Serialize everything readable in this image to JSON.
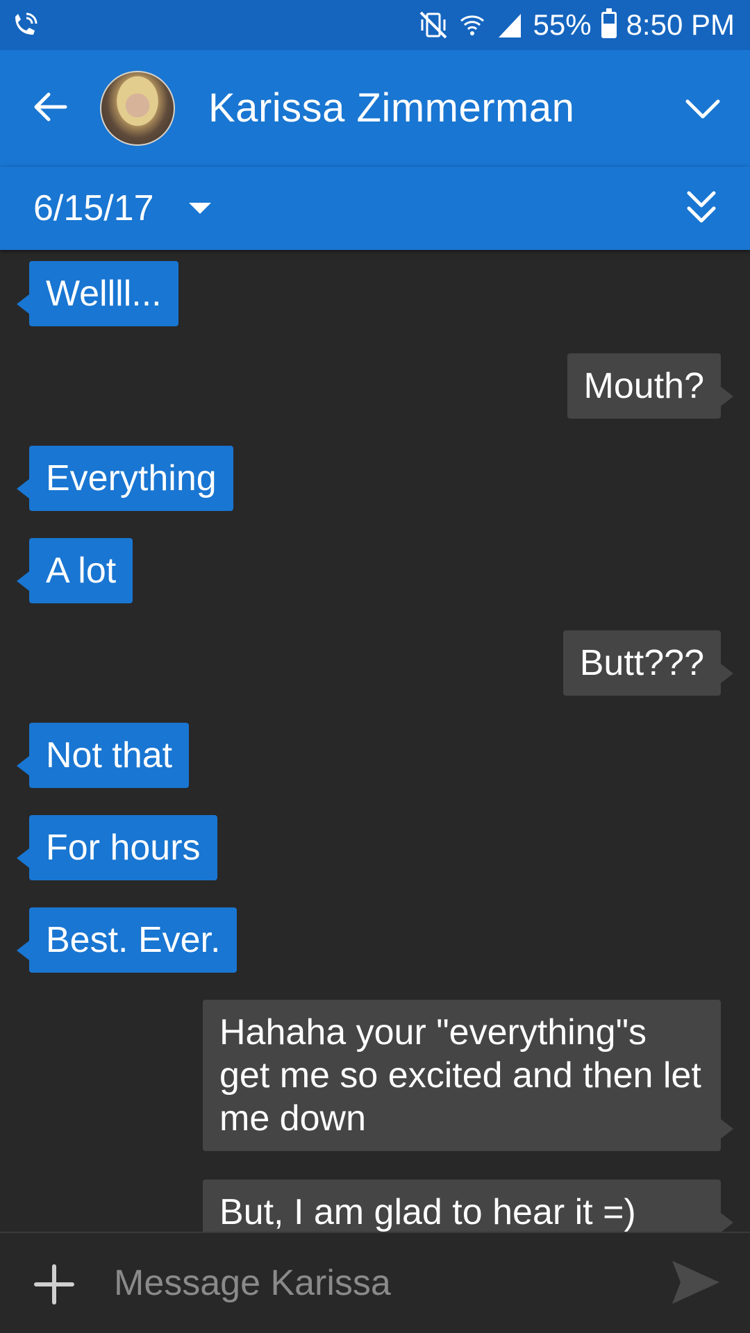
{
  "status_bar": {
    "battery_percent": "55%",
    "battery_level": 0.55,
    "time": "8:50 PM",
    "icons": [
      "wifi-calling-icon",
      "vibrate-mute-icon",
      "wifi-icon",
      "signal-icon",
      "battery-icon"
    ]
  },
  "header": {
    "contact_name": "Karissa Zimmerman",
    "back_icon": "arrow-left-icon",
    "expand_icon": "chevron-down-icon"
  },
  "date_bar": {
    "date": "6/15/17",
    "scroll_icon": "double-chevron-down-icon"
  },
  "messages": [
    {
      "direction": "in",
      "text": "Wellll..."
    },
    {
      "direction": "out",
      "text": "Mouth?"
    },
    {
      "direction": "in",
      "text": "Everything"
    },
    {
      "direction": "in",
      "text": "A lot"
    },
    {
      "direction": "out",
      "text": "Butt???"
    },
    {
      "direction": "in",
      "text": "Not that"
    },
    {
      "direction": "in",
      "text": "For hours"
    },
    {
      "direction": "in",
      "text": "Best. Ever."
    },
    {
      "direction": "out",
      "text": "Hahaha your \"everything\"s get me so excited and then let me down"
    },
    {
      "direction": "out",
      "text": "But, I am glad to hear it =)"
    }
  ],
  "compose": {
    "placeholder": "Message Karissa",
    "add_icon": "plus-icon",
    "send_icon": "send-icon"
  },
  "colors": {
    "incoming_bubble": "#1976d2",
    "outgoing_bubble": "#454545",
    "background": "#282828",
    "header": "#1976d2",
    "status_bar": "#1565bf"
  }
}
